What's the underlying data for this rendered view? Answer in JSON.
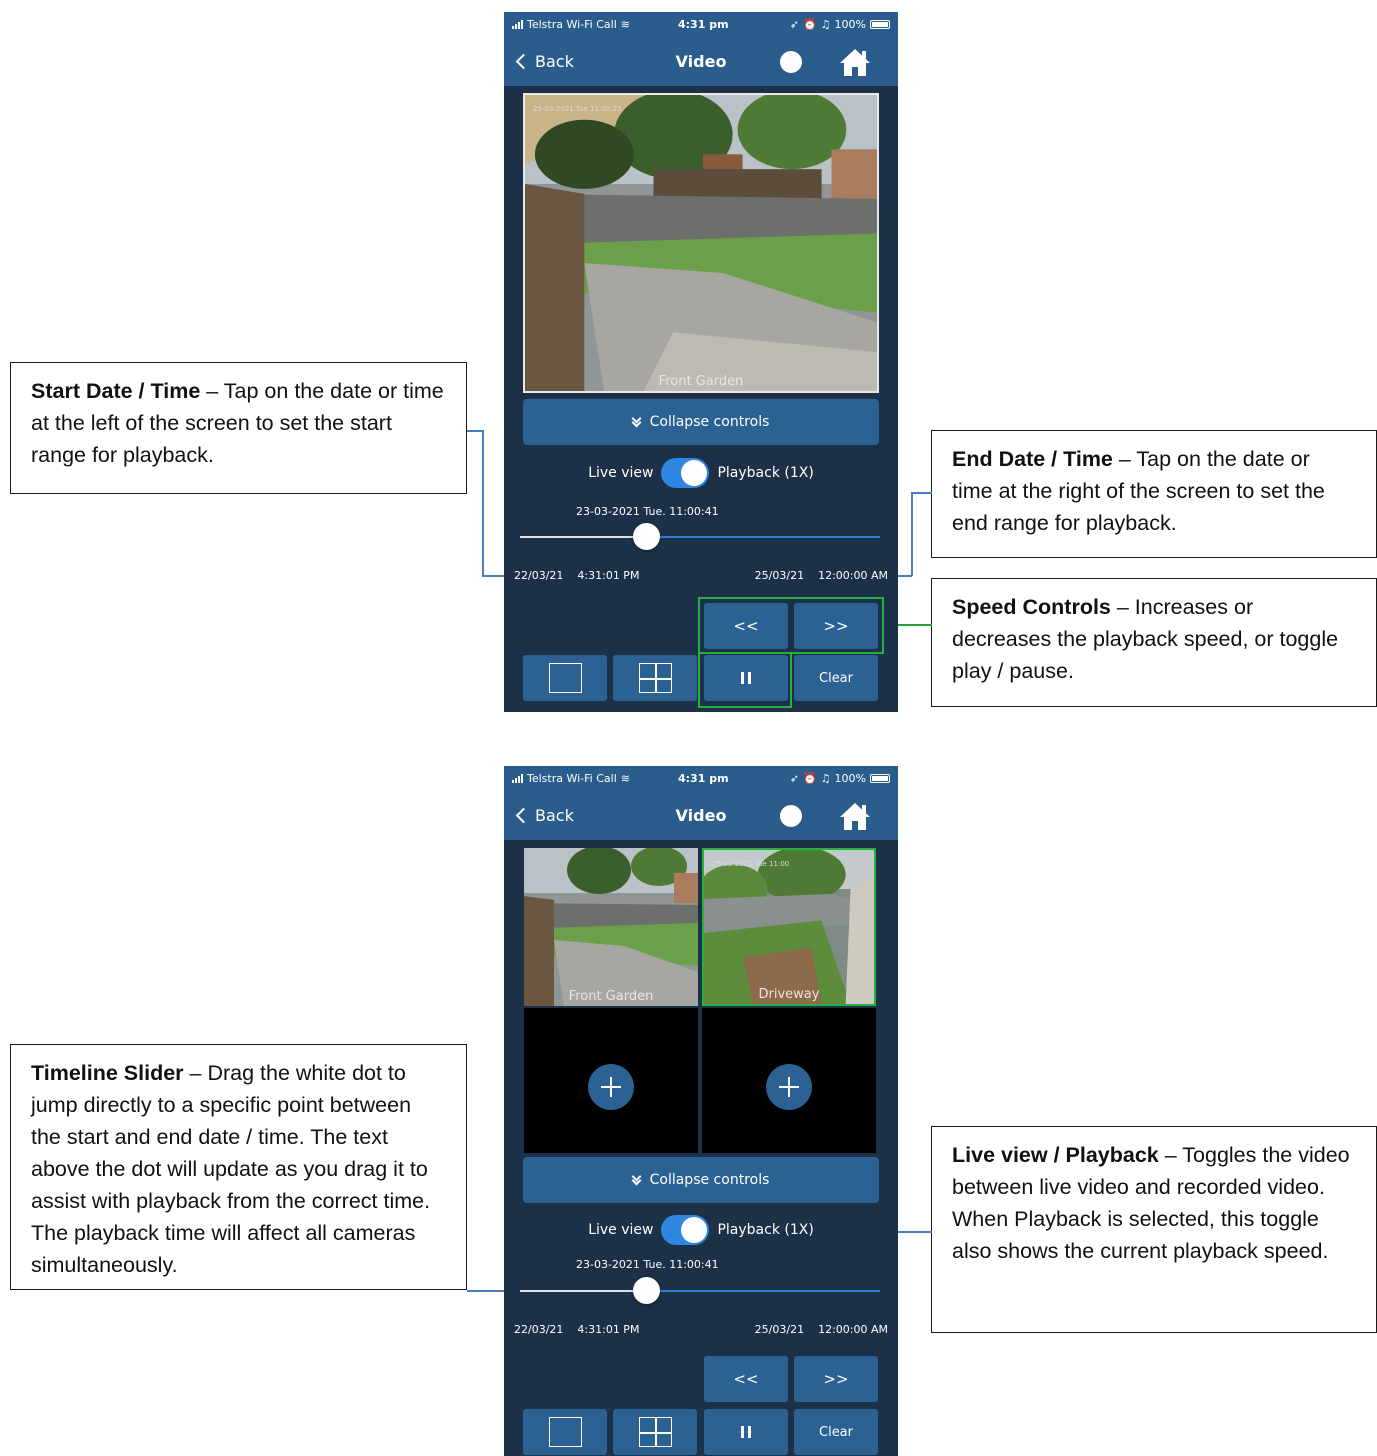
{
  "notes": {
    "start": {
      "title": "Start Date / Time",
      "text": " – Tap on the date or time at the left of the screen to set the start range for playback."
    },
    "end": {
      "title": "End Date / Time",
      "text": " – Tap on the date or time at the right of the screen to set the end range for playback."
    },
    "speed": {
      "title": "Speed Controls",
      "text": " – Increases or decreases the playback speed, or toggle play / pause."
    },
    "timeline": {
      "title": "Timeline Slider",
      "text": " – Drag the white dot to jump directly to a specific point between the start and end date / time. The text above the dot will update as you drag it to assist with playback from the correct time. The playback time will affect all cameras simultaneously."
    },
    "liveview": {
      "title": "Live view / Playback",
      "text": " – Toggles the video between live video and recorded video. When Playback is selected, this toggle also shows the current playback speed."
    }
  },
  "status": {
    "carrier": "Telstra Wi-Fi Call",
    "time": "4:31 pm",
    "battery": "100%"
  },
  "nav": {
    "back": "Back",
    "title": "Video"
  },
  "cameras": {
    "front_garden": "Front Garden",
    "driveway": "Driveway",
    "ts_front": "25-03-2021 Tue 11:00:23",
    "ts_drive": "25-03-2021 Tue 11:00"
  },
  "controls": {
    "collapse": "Collapse controls",
    "live_view": "Live view",
    "playback": "Playback (1X)",
    "slider_date": "23-03-2021 Tue. 11:00:41",
    "slider_position": 0.35,
    "start_date": "22/03/21",
    "start_time": "4:31:01 PM",
    "end_date": "25/03/21",
    "end_time": "12:00:00 AM",
    "rewind": "<<",
    "forward": ">>",
    "clear": "Clear"
  },
  "colors": {
    "accent": "#2b6193",
    "background": "#1c3147",
    "toggle": "#2f86e0",
    "highlight": "#22b33a",
    "connector": "#4a7fbf"
  }
}
